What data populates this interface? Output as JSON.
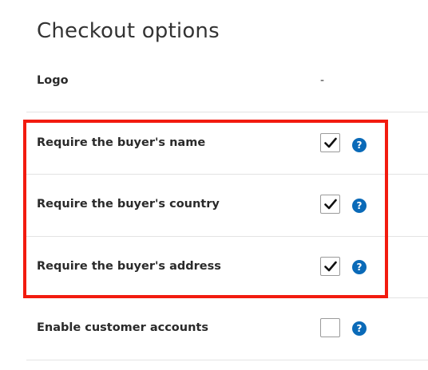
{
  "page": {
    "title": "Checkout options"
  },
  "logo": {
    "label": "Logo",
    "value": "-"
  },
  "options": [
    {
      "label": "Require the buyer's name",
      "checked": true,
      "help": "?"
    },
    {
      "label": "Require the buyer's country",
      "checked": true,
      "help": "?"
    },
    {
      "label": "Require the buyer's address",
      "checked": true,
      "help": "?"
    },
    {
      "label": "Enable customer accounts",
      "checked": false,
      "help": "?"
    }
  ],
  "colors": {
    "highlight": "#f21b0f",
    "help_icon": "#0a6ab8",
    "divider": "#e3e3e3"
  }
}
